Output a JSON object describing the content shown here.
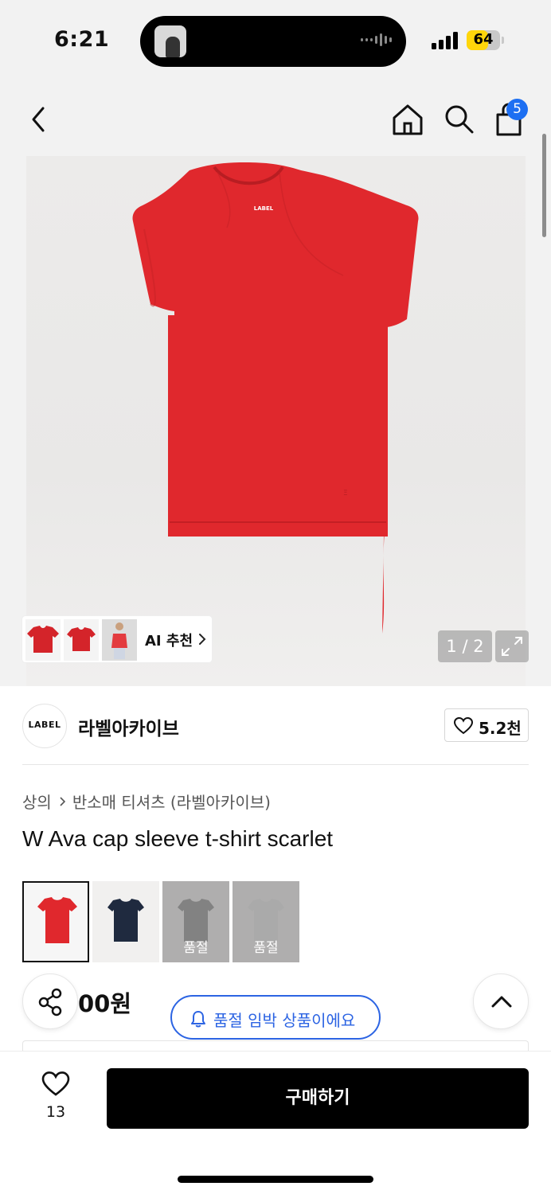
{
  "status_bar": {
    "time": "6:21",
    "battery": "64",
    "battery_level": 0.64
  },
  "nav": {
    "cart_count": "5"
  },
  "gallery": {
    "shirt_color": "#e0282d",
    "shirt_label": "LABEL",
    "ai_recommend_label": "AI 추천",
    "page_indicator": "1 / 2"
  },
  "brand": {
    "logo_text": "LABEL",
    "name": "라벨아카이브",
    "like_count": "5.2천"
  },
  "breadcrumb": [
    "상의",
    "반소매 티셔츠 (라벨아카이브)"
  ],
  "product": {
    "title": "W Ava cap sleeve t-shirt scarlet",
    "price": "00원"
  },
  "color_options": [
    {
      "color": "#e0282d",
      "selected": true,
      "soldout_label": ""
    },
    {
      "color": "#1f2a3f",
      "selected": false,
      "soldout_label": ""
    },
    {
      "color": "#8e8e8e",
      "selected": false,
      "soldout_label": "품절"
    },
    {
      "color": "#e6e6e6",
      "selected": false,
      "soldout_label": "품절"
    }
  ],
  "stock_notice": "품절 임박 상품이에요",
  "bottom_bar": {
    "wish_count": "13",
    "buy_label": "구매하기"
  },
  "colors": {
    "accent_blue": "#2c64e3",
    "badge_blue": "#1d6ff2",
    "buy_button": "#000000"
  }
}
